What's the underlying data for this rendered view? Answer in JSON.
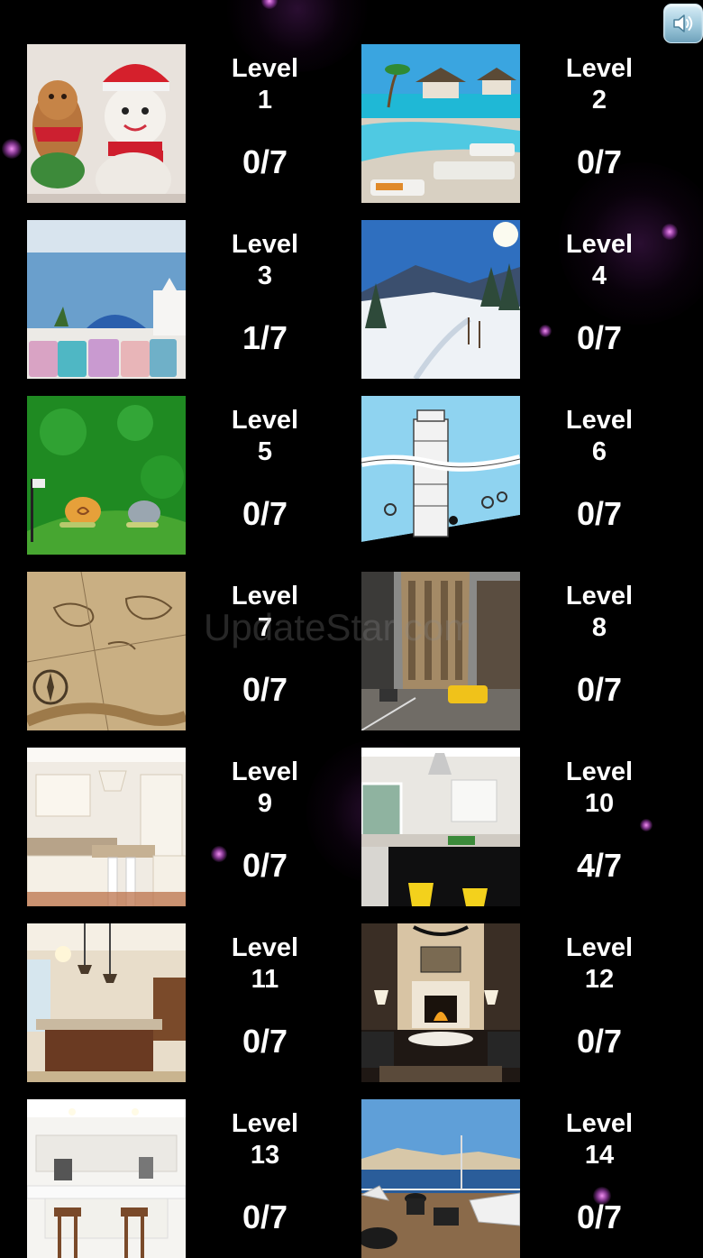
{
  "levels": [
    {
      "word": "Level",
      "number": "1",
      "progress": "0/7",
      "theme": "snowman-gingerbread"
    },
    {
      "word": "Level",
      "number": "2",
      "progress": "0/7",
      "theme": "tropical-pool"
    },
    {
      "word": "Level",
      "number": "3",
      "progress": "1/7",
      "theme": "santorini-sea"
    },
    {
      "word": "Level",
      "number": "4",
      "progress": "0/7",
      "theme": "snowy-forest"
    },
    {
      "word": "Level",
      "number": "5",
      "progress": "0/7",
      "theme": "cartoon-snails"
    },
    {
      "word": "Level",
      "number": "6",
      "progress": "0/7",
      "theme": "leaning-tower-drawing"
    },
    {
      "word": "Level",
      "number": "7",
      "progress": "0/7",
      "theme": "old-map"
    },
    {
      "word": "Level",
      "number": "8",
      "progress": "0/7",
      "theme": "city-street-taxi"
    },
    {
      "word": "Level",
      "number": "9",
      "progress": "0/7",
      "theme": "white-kitchen"
    },
    {
      "word": "Level",
      "number": "10",
      "progress": "4/7",
      "theme": "kitchen-yellow-stools"
    },
    {
      "word": "Level",
      "number": "11",
      "progress": "0/7",
      "theme": "kitchen-island"
    },
    {
      "word": "Level",
      "number": "12",
      "progress": "0/7",
      "theme": "fireplace-lounge"
    },
    {
      "word": "Level",
      "number": "13",
      "progress": "0/7",
      "theme": "modern-kitchen"
    },
    {
      "word": "Level",
      "number": "14",
      "progress": "0/7",
      "theme": "sea-terrace"
    }
  ],
  "sound_button": {
    "icon": "speaker-icon"
  },
  "watermark": "UpdateStar.com",
  "colors": {
    "background": "#000000",
    "text": "#ffffff",
    "sparkle": "#e080f0"
  }
}
